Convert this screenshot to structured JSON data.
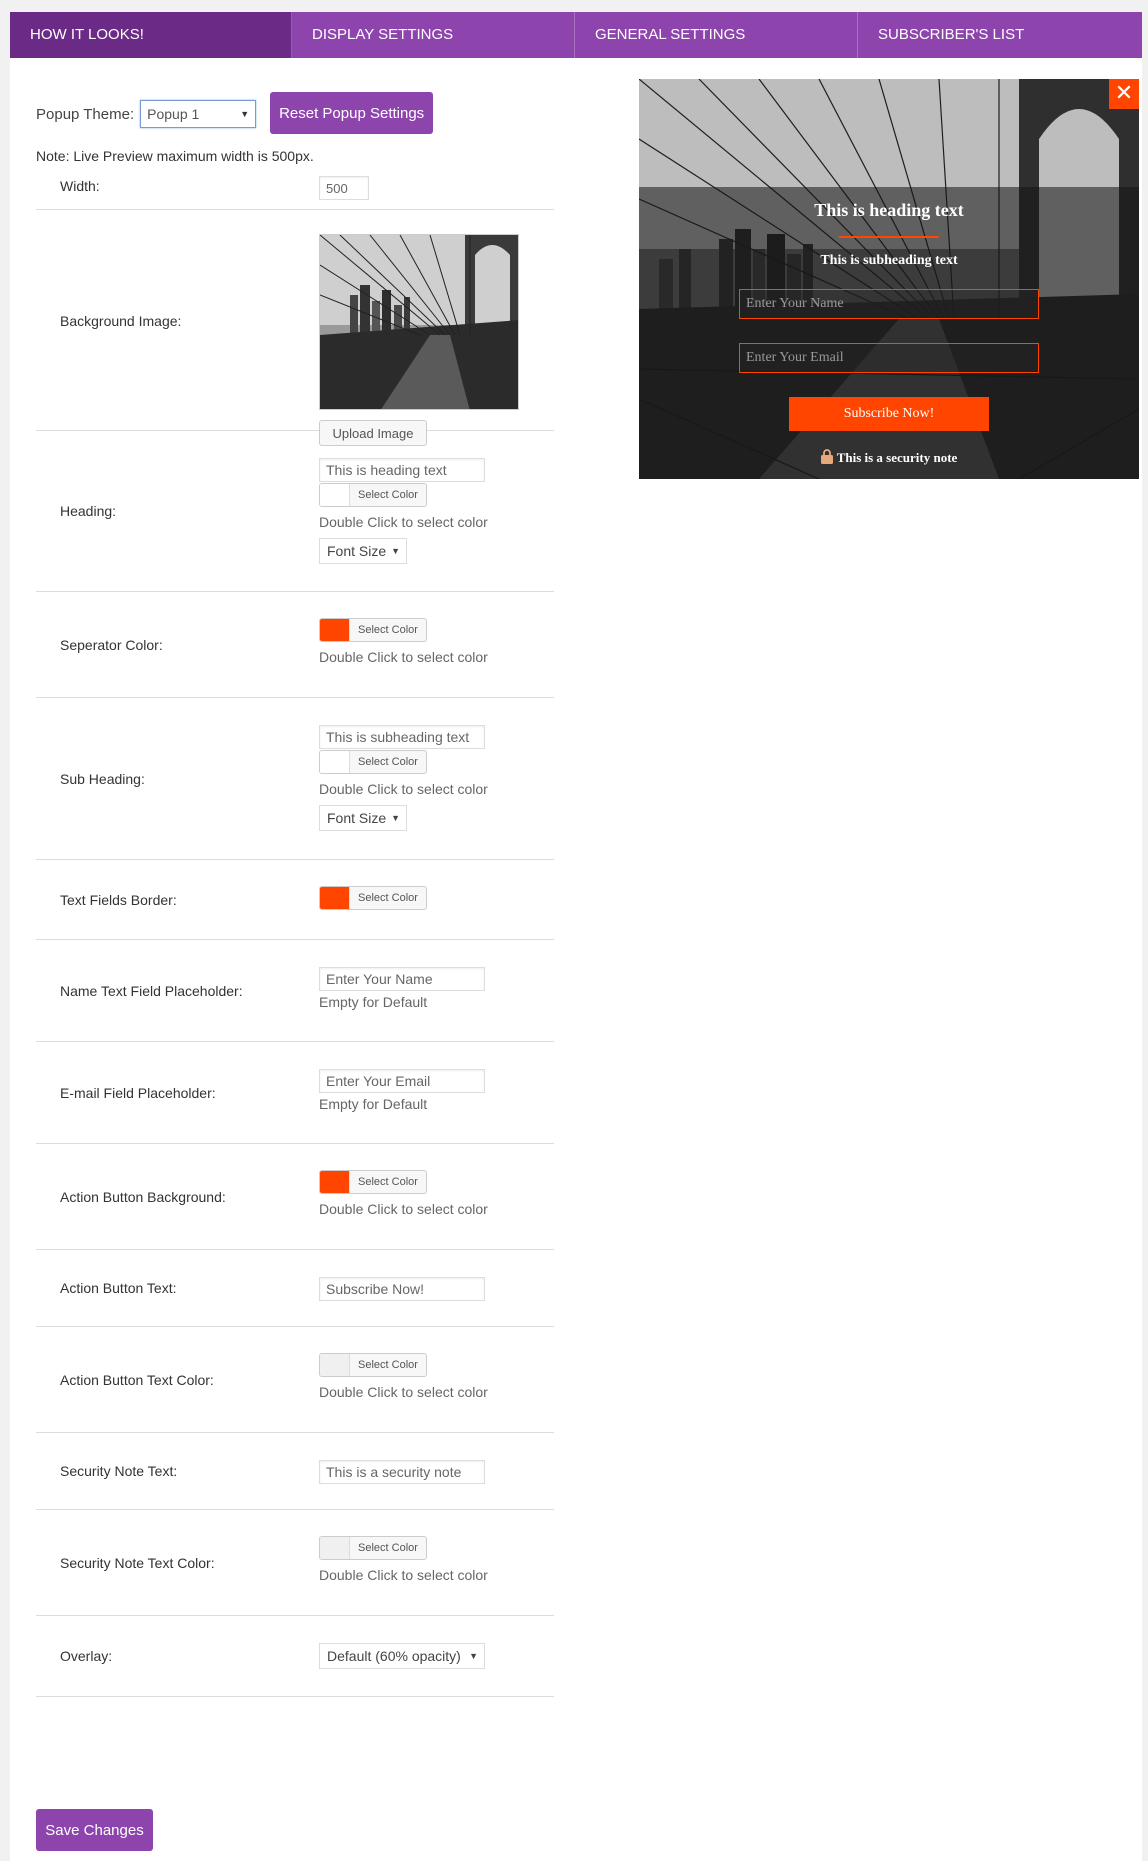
{
  "tabs": [
    {
      "label": "How It Looks!"
    },
    {
      "label": "Display Settings"
    },
    {
      "label": "General Settings"
    },
    {
      "label": "Subscriber's List"
    }
  ],
  "theme": {
    "label": "Popup Theme:",
    "selected": "Popup 1",
    "reset_label": "Reset Popup Settings",
    "note": "Note: Live Preview maximum width is 500px."
  },
  "fields": {
    "width": {
      "label": "Width:",
      "value": "500"
    },
    "background": {
      "label": "Background Image:",
      "upload_label": "Upload Image"
    },
    "heading": {
      "label": "Heading:",
      "value": "This is heading text",
      "color_label": "Select Color",
      "help": "Double Click to select color",
      "font_size": "Font Size"
    },
    "separator": {
      "label": "Seperator Color:",
      "color": "#ff4500",
      "color_label": "Select Color",
      "help": "Double Click to select color"
    },
    "subheading": {
      "label": "Sub Heading:",
      "value": "This is subheading text",
      "color_label": "Select Color",
      "help": "Double Click to select color",
      "font_size": "Font Size"
    },
    "border": {
      "label": "Text Fields Border:",
      "color": "#ff4500",
      "color_label": "Select Color"
    },
    "name_placeholder": {
      "label": "Name Text Field Placeholder:",
      "value": "Enter Your Name",
      "help": "Empty for Default"
    },
    "email_placeholder": {
      "label": "E-mail Field Placeholder:",
      "value": "Enter Your Email",
      "help": "Empty for Default"
    },
    "action_bg": {
      "label": "Action Button Background:",
      "color": "#ff4500",
      "color_label": "Select Color",
      "help": "Double Click to select color"
    },
    "action_text": {
      "label": "Action Button Text:",
      "value": "Subscribe Now!"
    },
    "action_text_color": {
      "label": "Action Button Text Color:",
      "color_label": "Select Color",
      "help": "Double Click to select color"
    },
    "security_text": {
      "label": "Security Note Text:",
      "value": "This is a security note"
    },
    "security_color": {
      "label": "Security Note Text Color:",
      "color_label": "Select Color",
      "help": "Double Click to select color"
    },
    "overlay": {
      "label": "Overlay:",
      "selected": "Default (60% opacity)"
    }
  },
  "save_label": "Save Changes",
  "preview": {
    "heading": "This is heading text",
    "subheading": "This is subheading text",
    "name_placeholder": "Enter Your Name",
    "email_placeholder": "Enter Your Email",
    "button": "Subscribe Now!",
    "security": "This is a security note",
    "close_icon": "close-icon",
    "accent": "#ff4500"
  },
  "colors": {
    "purple": "#8e44ad",
    "purple_active": "#6a2a86",
    "accent": "#ff4500"
  }
}
